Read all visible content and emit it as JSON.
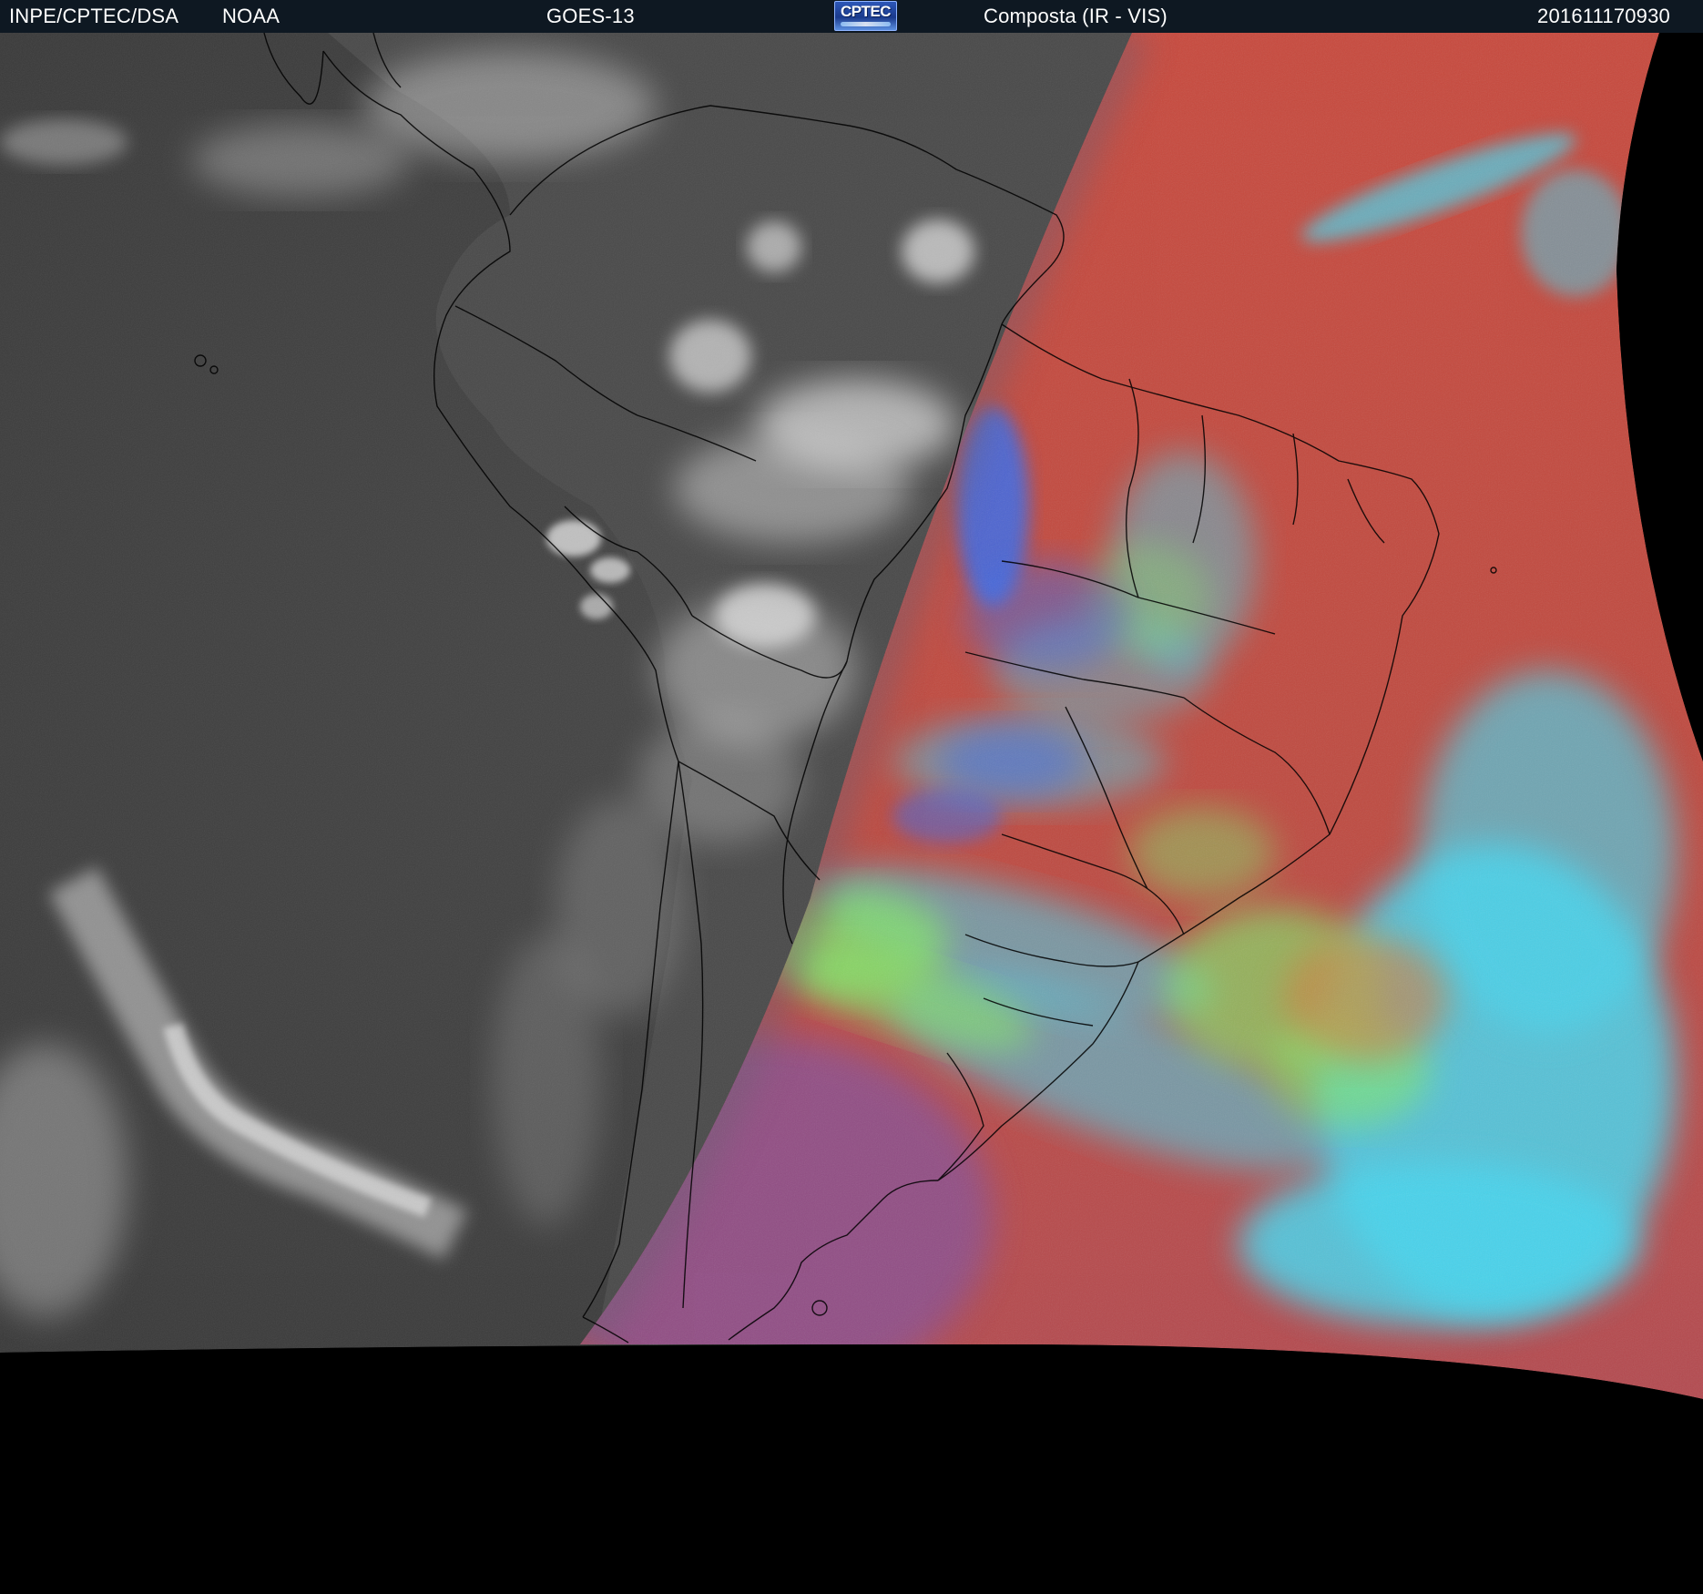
{
  "header": {
    "organization": "INPE/CPTEC/DSA",
    "agency": "NOAA",
    "satellite": "GOES-13",
    "logo_text": "CPTEC",
    "product": "Composta (IR - VIS)",
    "timestamp": "201611170930"
  },
  "colors": {
    "header_background": "#0e1822",
    "space_background": "#000000",
    "ir_night_base": "#3c3c3c",
    "ir_cloud": "#d8d8d8",
    "vis_day_base": "#c04a3e",
    "vis_cloud_cyan": "#44d4ee",
    "vis_cloud_green": "#7ee66a",
    "vis_cloud_blue": "#3a6ee8",
    "vis_ocean_purple": "#8a4e8e",
    "border_lines": "#000000"
  }
}
